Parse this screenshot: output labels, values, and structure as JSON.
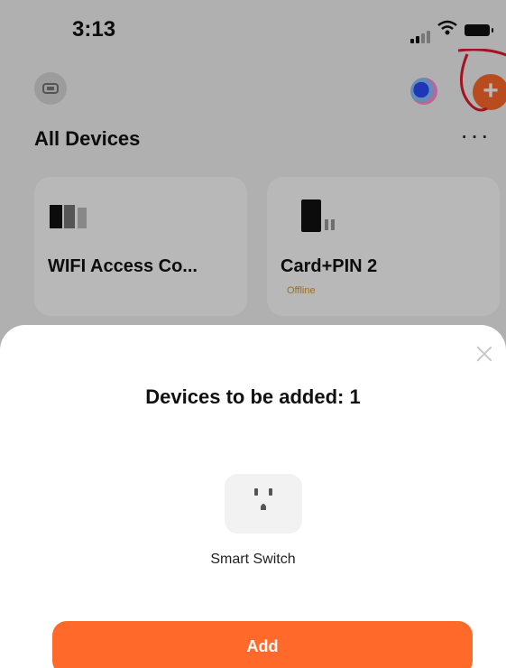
{
  "status": {
    "time": "3:13"
  },
  "header": {
    "title": "All Devices",
    "add_icon_glyph": "+",
    "more_glyph": "···"
  },
  "devices": [
    {
      "name": "WIFI Access Co...",
      "status": ""
    },
    {
      "name": "Card+PIN 2",
      "status": "Offline"
    }
  ],
  "sheet": {
    "title": "Devices to be added: 1",
    "device_name": "Smart Switch",
    "action_label": "Add"
  },
  "colors": {
    "accent": "#ff6a2a",
    "overlay": "rgba(0,0,0,0.28)",
    "offline": "#d59a2c",
    "annotation": "#e11b32"
  },
  "icons": {
    "home": "home-icon",
    "assistant": "assistant-icon",
    "add": "plus-icon",
    "more": "more-icon",
    "close": "close-icon",
    "device_a": "access-controller-icon",
    "device_b": "card-reader-icon",
    "outlet": "smart-outlet-icon",
    "signal": "signal-icon",
    "wifi": "wifi-icon",
    "battery": "battery-icon"
  }
}
